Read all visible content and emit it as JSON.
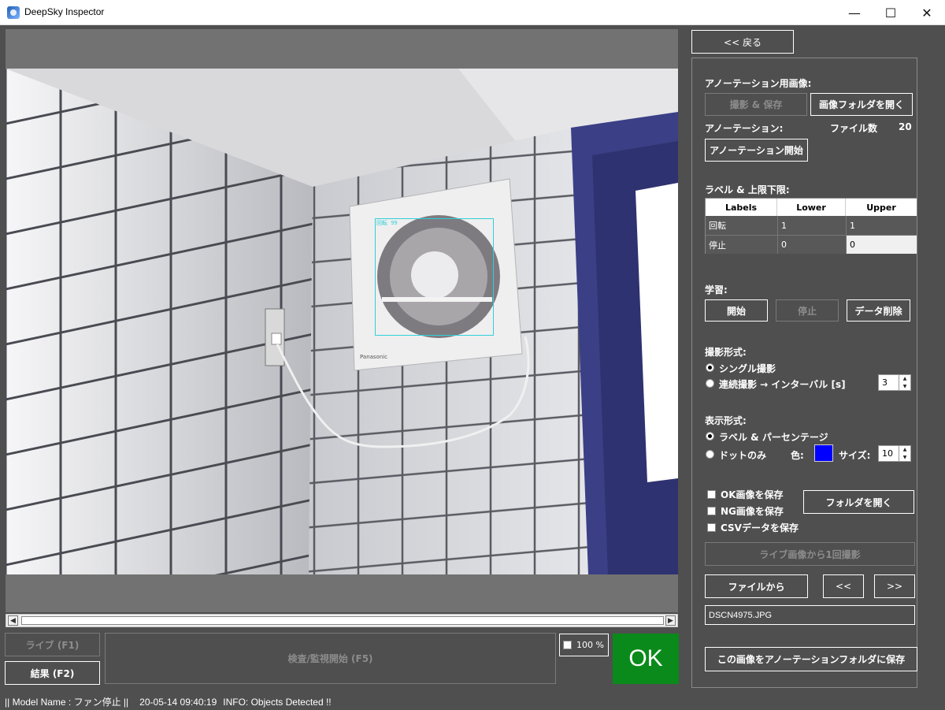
{
  "window": {
    "title": "DeepSky Inspector",
    "minimize": "—",
    "maximize": "☐",
    "close": "✕"
  },
  "photo": {
    "detection_label": "回転 99",
    "detection_color": "#2fd0d8"
  },
  "controls": {
    "live_label": "ライブ (F1)",
    "result_label": "結果 (F2)",
    "start_inspect_label": "検査/監視開始 (F5)",
    "zoom_label": "100 %",
    "verdict": "OK",
    "verdict_color": "#0a8a1a"
  },
  "status": {
    "model": "|| Model Name : ファン停止 ||",
    "timestamp": "20-05-14 09:40:19",
    "info": "INFO:   Objects Detected !!"
  },
  "panel": {
    "back_label": "<< 戻る",
    "annot_image_heading": "アノーテーション用画像:",
    "capture_save_label": "撮影 & 保存",
    "open_image_folder_label": "画像フォルダを開く",
    "annotation_heading": "アノーテーション:",
    "file_count_label": "ファイル数",
    "file_count": "20",
    "start_annotation_label": "アノーテーション開始",
    "labels_heading": "ラベル & 上限下限:",
    "table": {
      "headers": [
        "Labels",
        "Lower",
        "Upper"
      ],
      "rows": [
        [
          "回転",
          "1",
          "1"
        ],
        [
          "停止",
          "0",
          "0"
        ]
      ]
    },
    "learning_heading": "学習:",
    "learn_start_label": "開始",
    "learn_stop_label": "停止",
    "data_delete_label": "データ削除",
    "capture_mode_heading": "撮影形式:",
    "single_capture_label": "シングル撮影",
    "interval_capture_label": "連続撮影 → インターバル [s]",
    "interval_value": "3",
    "display_mode_heading": "表示形式:",
    "label_percent_label": "ラベル & パーセンテージ",
    "dot_only_label": "ドットのみ",
    "color_label": "色:",
    "dot_color": "#0000ff",
    "size_label": "サイズ:",
    "size_value": "10",
    "save_ok_label": "OK画像を保存",
    "save_ng_label": "NG画像を保存",
    "save_csv_label": "CSVデータを保存",
    "open_folder_label": "フォルダを開く",
    "capture_once_label": "ライブ画像から1回撮影",
    "from_file_label": "ファイルから",
    "prev_label": "<<",
    "next_label": ">>",
    "filename": "DSCN4975.JPG",
    "save_to_annotation_label": "この画像をアノーテーションフォルダに保存"
  }
}
